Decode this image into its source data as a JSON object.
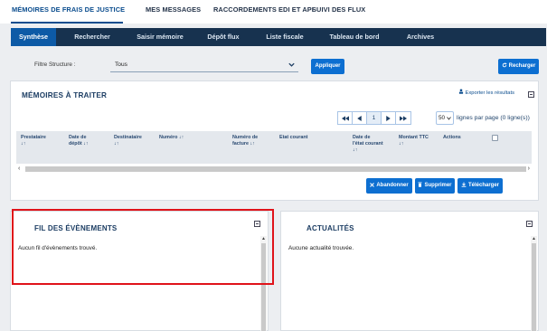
{
  "top_nav": {
    "tabs": [
      "MÉMOIRES DE FRAIS DE JUSTICE",
      "MES MESSAGES",
      "RACCORDEMENTS EDI ET API",
      "SUIVI DES FLUX"
    ]
  },
  "main_nav": {
    "tabs": [
      "Synthèse",
      "Rechercher",
      "Saisir mémoire",
      "Dépôt flux",
      "Liste fiscale",
      "Tableau de bord",
      "Archives"
    ],
    "active": "Synthèse"
  },
  "filter": {
    "label": "Filtre Structure :",
    "value": "Tous",
    "apply_label": "Appliquer",
    "reload_label": "Recharger"
  },
  "memoires_panel": {
    "title": "Mémoires à traiter",
    "export_label": "Exporter les résultats",
    "pager": {
      "current_page": "1",
      "page_size": "50",
      "page_size_label": "lignes par page (0 ligne(s))"
    },
    "columns": [
      [
        "Prestataire",
        ""
      ],
      [
        "Date de",
        "dépôt"
      ],
      [
        "Destinataire",
        ""
      ],
      [
        "Numéro",
        ""
      ],
      [
        "Numéro de",
        "facture"
      ],
      [
        "Etat courant",
        ""
      ],
      [
        "Date de",
        "l'état courant"
      ],
      [
        "Montant TTC",
        ""
      ],
      [
        "Actions",
        ""
      ]
    ],
    "actions": {
      "abandon": "Abandonner",
      "delete": "Supprimer",
      "download": "Télécharger"
    }
  },
  "events_panel": {
    "title": "Fil des évènements",
    "empty_message": "Aucun fil d'évènements trouvé."
  },
  "news_panel": {
    "title": "Actualités",
    "empty_message": "Aucune actualité trouvée."
  },
  "colors": {
    "navbar": "#17324f",
    "active_tab": "#0d5aa6",
    "button": "#0d6fd1",
    "highlight_box": "#e0131a"
  }
}
